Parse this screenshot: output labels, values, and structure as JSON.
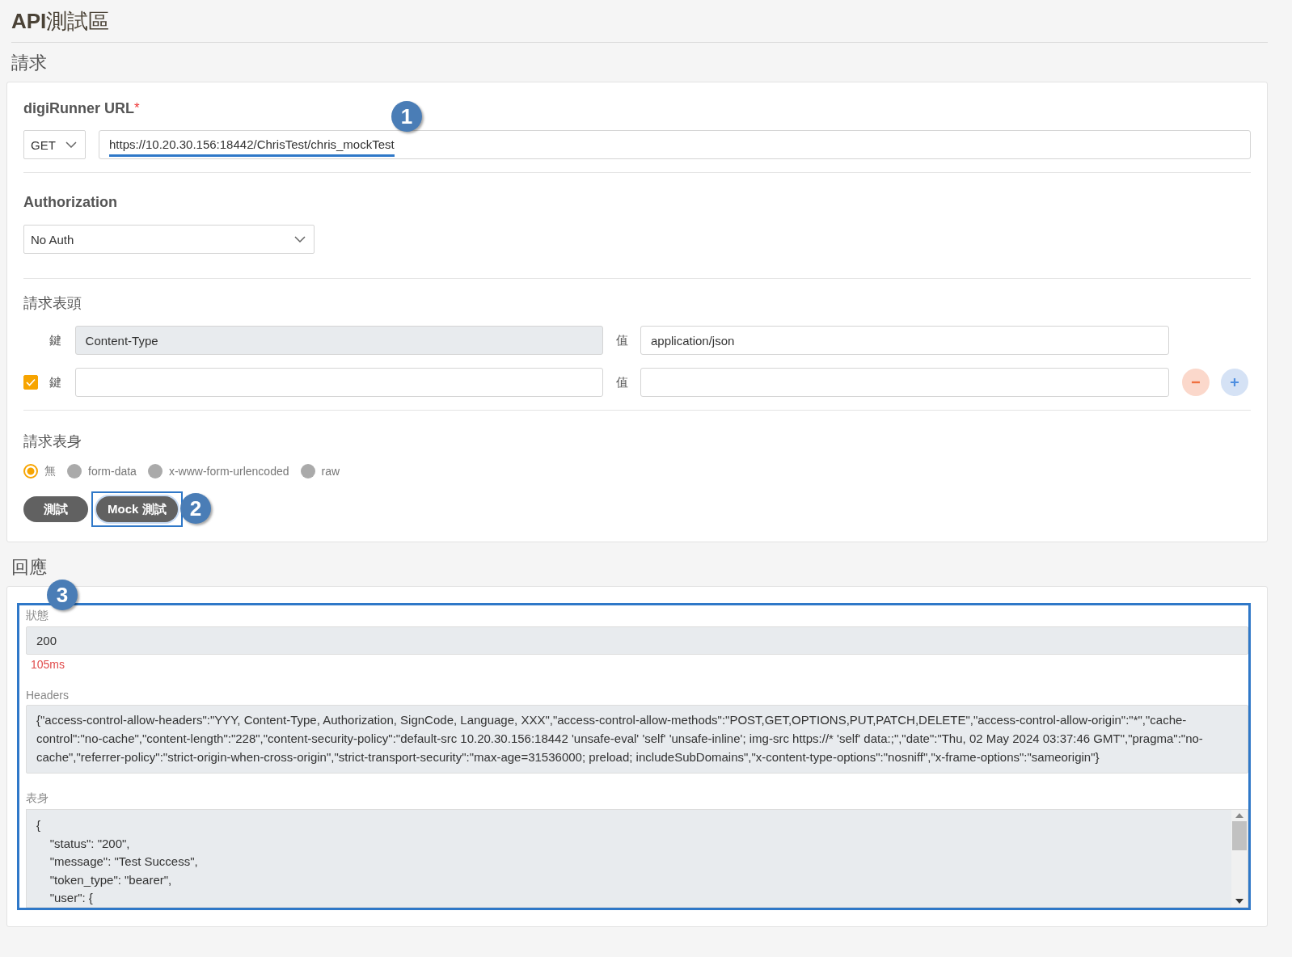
{
  "page_title": "**API**測試區",
  "request": {
    "heading": "請求",
    "url": {
      "label": "digiRunner URL",
      "required_mark": "*",
      "method": "GET",
      "value": "https://10.20.30.156:18442/ChrisTest/chris_mockTest",
      "highlighted": true,
      "callout": "1"
    },
    "authorization": {
      "label": "Authorization",
      "value": "No Auth"
    },
    "headers": {
      "heading": "請求表頭",
      "rows": [
        {
          "kind": "fixed",
          "key_label": "鍵",
          "key": "Content-Type",
          "value_label": "值",
          "value": "application/json"
        },
        {
          "kind": "editable",
          "checked": true,
          "key_label": "鍵",
          "value_label": "值"
        }
      ]
    },
    "body": {
      "heading": "請求表身",
      "options": [
        {
          "label": "無",
          "selected": true
        },
        {
          "label": "form-data",
          "selected": false
        },
        {
          "label": "x-www-form-urlencoded",
          "selected": false
        },
        {
          "label": "raw",
          "selected": false
        }
      ]
    },
    "buttons": [
      {
        "label": "測試",
        "highlighted": false
      },
      {
        "label": "Mock 測試",
        "highlighted": true,
        "callout": "2"
      }
    ]
  },
  "response": {
    "heading": "回應",
    "callout": "3",
    "highlighted": true,
    "status_label": "狀態",
    "status": "200",
    "elapsed": "105ms",
    "headers_label": "Headers",
    "headers": "{\"access-control-allow-headers\":\"YYY, Content-Type, Authorization, SignCode, Language, XXX\",\"access-control-allow-methods\":\"POST,GET,OPTIONS,PUT,PATCH,DELETE\",\"access-control-allow-origin\":\"*\",\"cache-control\":\"no-cache\",\"content-length\":\"228\",\"content-security-policy\":\"default-src 10.20.30.156:18442 'unsafe-eval' 'self' 'unsafe-inline'; img-src https://* 'self' data:;\",\"date\":\"Thu, 02 May 2024 03:37:46 GMT\",\"pragma\":\"no-cache\",\"referrer-policy\":\"strict-origin-when-cross-origin\",\"strict-transport-security\":\"max-age=31536000; preload; includeSubDomains\",\"x-content-type-options\":\"nosniff\",\"x-frame-options\":\"sameorigin\"}",
    "body_label": "表身",
    "body_lines": [
      "{",
      "    \"status\": \"200\",",
      "    \"message\": \"Test Success\",",
      "    \"token_type\": \"bearer\",",
      "    \"user\": {"
    ]
  }
}
